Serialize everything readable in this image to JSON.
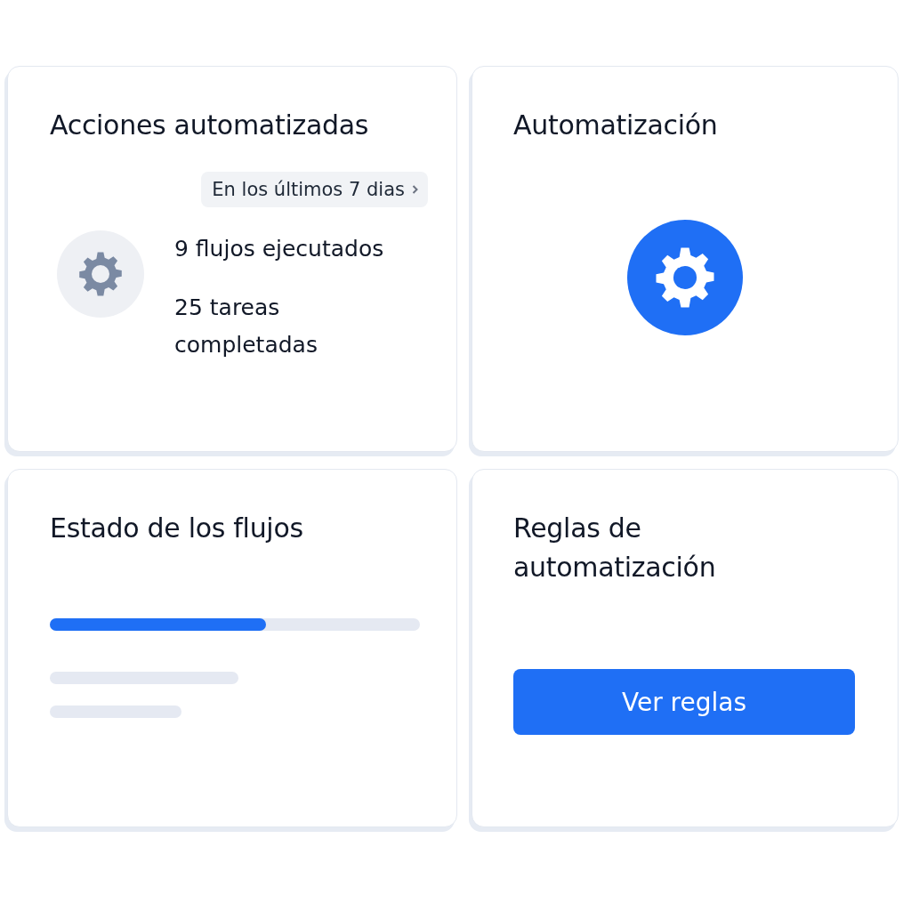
{
  "actions_card": {
    "title": "Acciones automatizadas",
    "period_button": "En los últimos 7 dias",
    "stats": [
      "9 flujos ejecutados",
      "25 tareas completadas"
    ]
  },
  "automation_card": {
    "title": "Automatización"
  },
  "flow_status_card": {
    "title": "Estado de los flujos",
    "progress": {
      "level": 0.585
    }
  },
  "rules_card": {
    "title": "Reglas de automatización",
    "button": "Ver reglas"
  }
}
